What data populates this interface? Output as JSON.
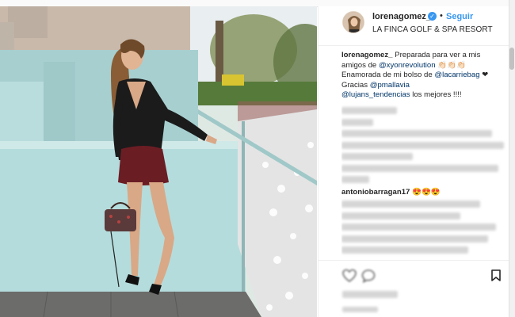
{
  "header": {
    "username": "lorenagomez_",
    "separator": "•",
    "follow_label": "Seguir",
    "location": "LA FINCA GOLF & SPA RESORT"
  },
  "caption": {
    "user": "lorenagomez_",
    "text_1": " Preparada para ver a mis amigos de ",
    "mention_1": "@xyonrevolution",
    "text_2": " 👏🏻👏🏻👏🏻 Enamorada de mi bolso de ",
    "mention_2": "@lacarriebag",
    "text_3": " ❤ Gracias ",
    "mention_3": "@pmallavia",
    "mention_4": "@lujans_tendencias",
    "text_4": " los mejores !!!!"
  },
  "comments": {
    "visible_user": "antoniobarragan17",
    "visible_text": " 😍😍😍"
  },
  "icons": {
    "verified": "verified-badge-icon",
    "like": "heart-icon",
    "comment": "comment-bubble-icon",
    "bookmark": "bookmark-icon"
  },
  "colors": {
    "link_blue": "#3897f0",
    "mention_blue": "#003569",
    "text": "#262626",
    "border": "#efefef"
  }
}
